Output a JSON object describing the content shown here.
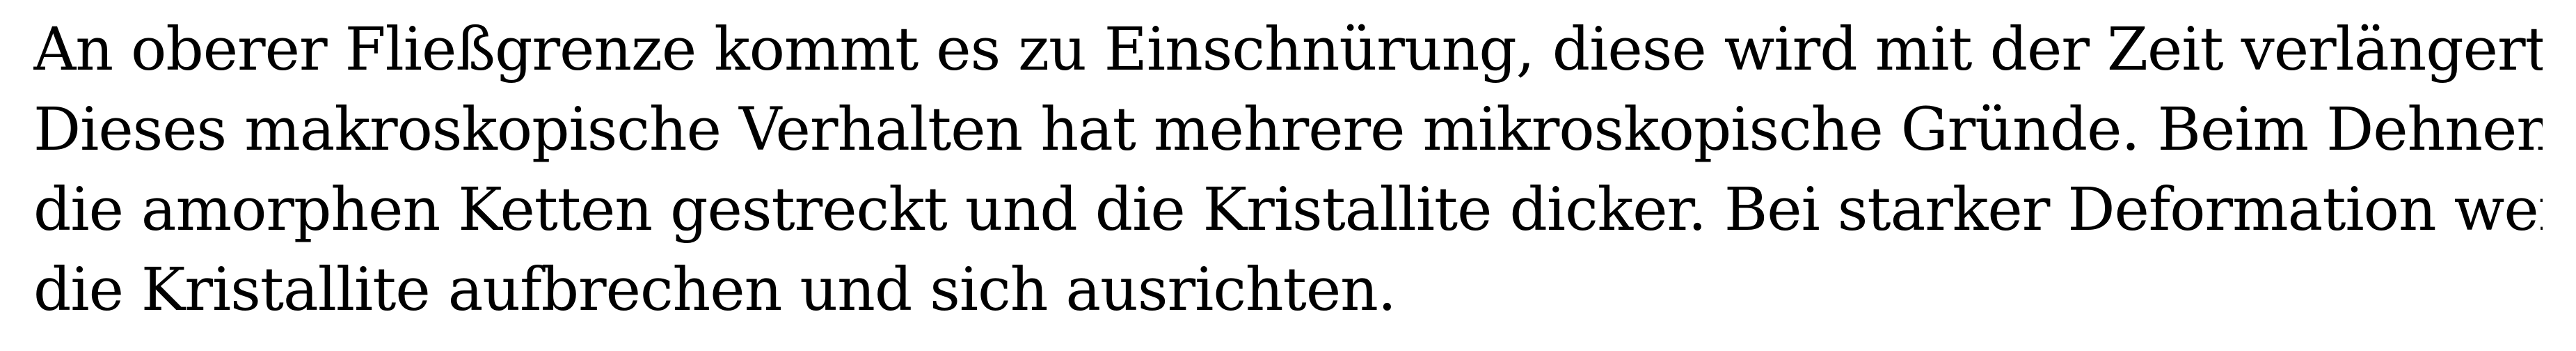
{
  "document": {
    "lines": [
      "An oberer Fließgrenze kommt es zu Einschnürung, diese wird mit der Zeit verlängert.",
      "Dieses makroskopische Verhalten hat mehrere mikroskopische Gründe. Beim Dehnen werden",
      "die amorphen Ketten gestreckt und die Kristallite dicker. Bei starker Deformation werden",
      "die Kristallite aufbrechen und sich ausrichten."
    ]
  }
}
